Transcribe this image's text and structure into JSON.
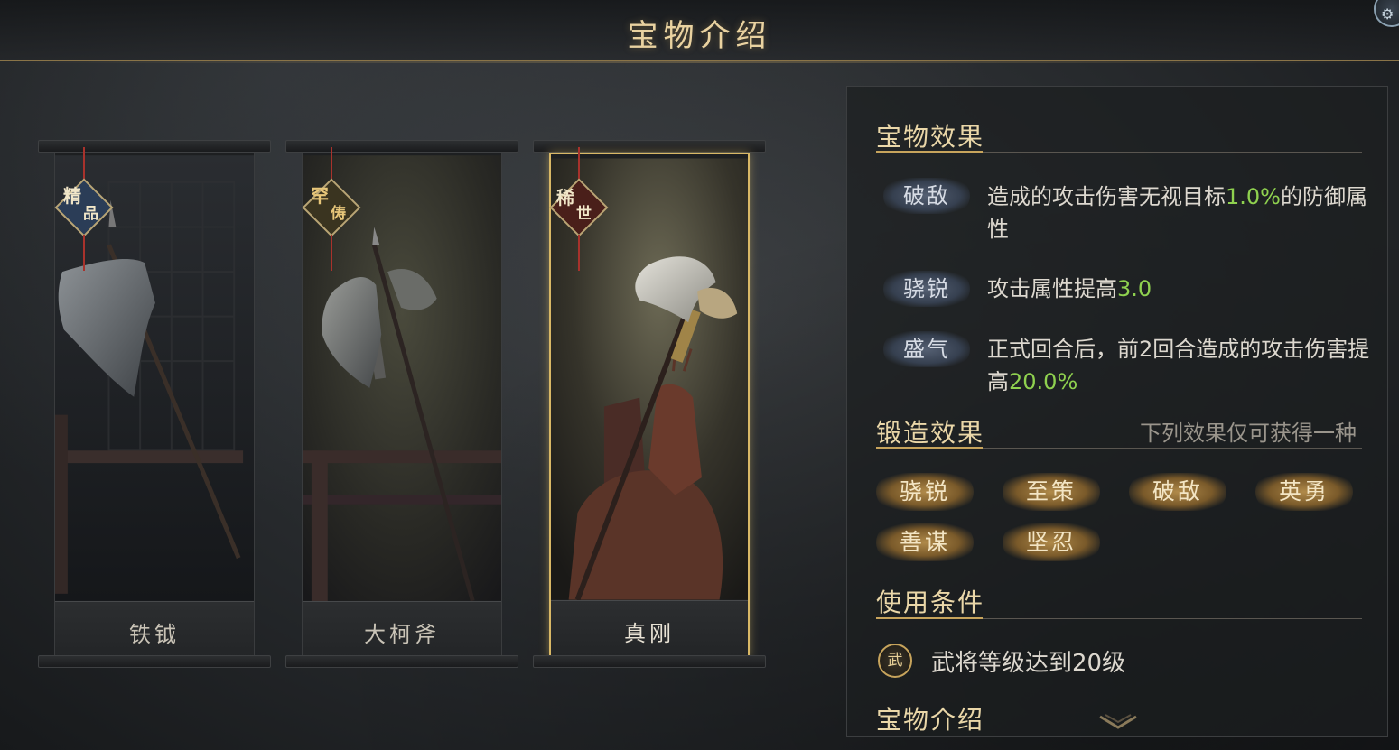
{
  "header": {
    "title": "宝物介绍"
  },
  "cards": [
    {
      "name": "铁钺",
      "rarity": [
        "精",
        "品"
      ],
      "selected": false
    },
    {
      "name": "大柯斧",
      "rarity": [
        "罕",
        "俦"
      ],
      "selected": false
    },
    {
      "name": "真刚",
      "rarity": [
        "稀",
        "世"
      ],
      "selected": true
    }
  ],
  "effects": {
    "title": "宝物效果",
    "items": [
      {
        "name": "破敌",
        "desc_pre": "造成的攻击伤害无视目标",
        "value": "1.0%",
        "desc_post": "的防御属性"
      },
      {
        "name": "骁锐",
        "desc_pre": "攻击属性提高",
        "value": "3.0",
        "desc_post": ""
      },
      {
        "name": "盛气",
        "desc_pre": "正式回合后，前2回合造成的攻击伤害提高",
        "value": "20.0%",
        "desc_post": ""
      }
    ]
  },
  "forge": {
    "title": "锻造效果",
    "note": "下列效果仅可获得一种",
    "options": [
      "骁锐",
      "至策",
      "破敌",
      "英勇",
      "善谋",
      "坚忍"
    ]
  },
  "conditions": {
    "title": "使用条件",
    "icon_char": "武",
    "text": "武将等级达到20级"
  },
  "intro": {
    "title": "宝物介绍"
  },
  "colors": {
    "accent_gold": "#c7a45c",
    "highlight_green": "#8fd14f",
    "selected_border": "#d9b866"
  },
  "icons": {
    "corner": "settings-gear-icon",
    "scroll": "chevron-down-icon",
    "condition": "general-rank-icon"
  }
}
